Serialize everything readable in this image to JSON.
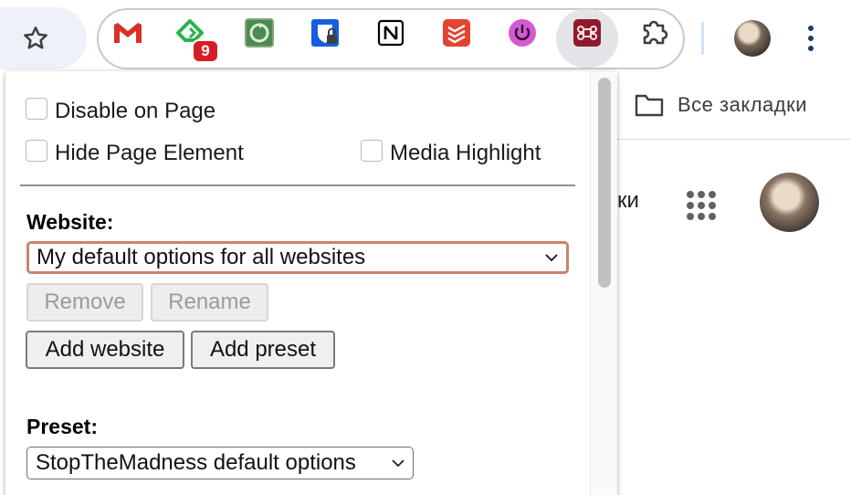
{
  "toolbar": {
    "extensions": [
      {
        "name": "gmail",
        "icon": "gmail-icon",
        "color": "#d93025"
      },
      {
        "name": "feedly",
        "icon": "feedly-icon",
        "color": "#2bb24c",
        "badge": "9"
      },
      {
        "name": "refresh-extension",
        "icon": "refresh-extension-icon",
        "color": "#3a7d44"
      },
      {
        "name": "bitwarden",
        "icon": "bitwarden-icon",
        "color": "#175ddc"
      },
      {
        "name": "notion",
        "icon": "notion-icon",
        "color": "#000000"
      },
      {
        "name": "todoist",
        "icon": "todoist-icon",
        "color": "#e44332"
      },
      {
        "name": "power",
        "icon": "power-icon",
        "color": "#d35ad1"
      },
      {
        "name": "stopthemadness",
        "icon": "command-key-icon",
        "color": "#8e1b2c"
      }
    ],
    "badge_count": "9"
  },
  "background_page": {
    "bookmarks_label": "Все закладки",
    "partial_text": "ки"
  },
  "popup": {
    "checkboxes": {
      "disable_on_page": "Disable on Page",
      "hide_page_element": "Hide Page Element",
      "media_highlight": "Media Highlight"
    },
    "website": {
      "label": "Website:",
      "selected": "My default options for all websites",
      "remove_label": "Remove",
      "rename_label": "Rename",
      "add_website_label": "Add website",
      "add_preset_label": "Add preset"
    },
    "preset": {
      "label": "Preset:",
      "selected": "StopTheMadness default options"
    }
  }
}
